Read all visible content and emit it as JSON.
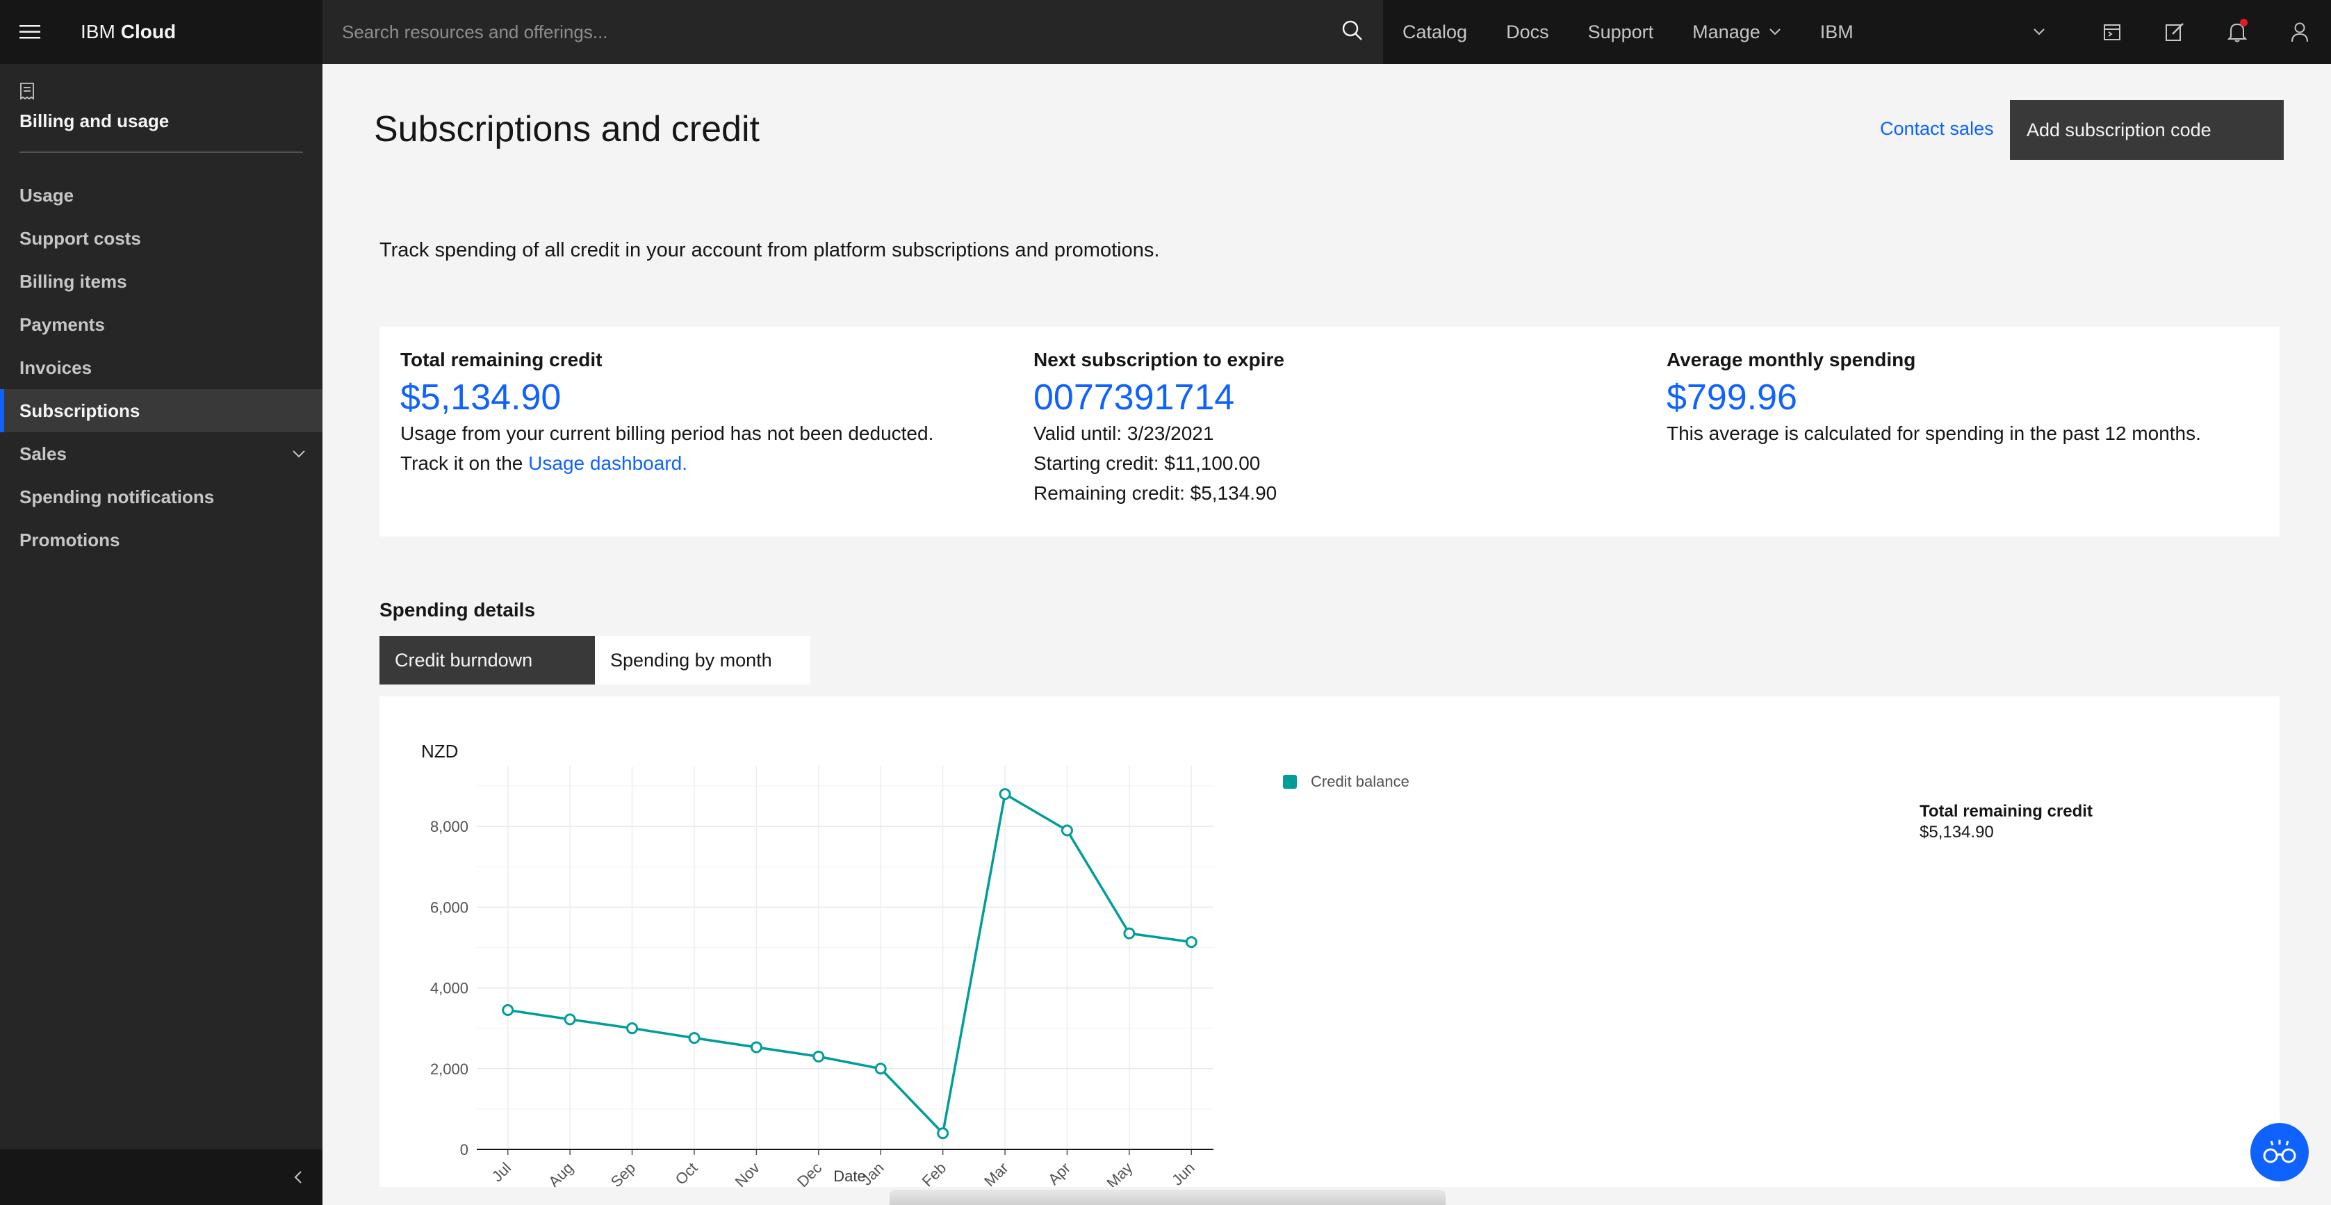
{
  "header": {
    "brand_prefix": "IBM",
    "brand_product": "Cloud",
    "search_placeholder": "Search resources and offerings...",
    "nav": [
      "Catalog",
      "Docs",
      "Support",
      "Manage"
    ],
    "account": "IBM"
  },
  "sidebar": {
    "title": "Billing and usage",
    "items": [
      {
        "label": "Usage"
      },
      {
        "label": "Support costs"
      },
      {
        "label": "Billing items"
      },
      {
        "label": "Payments"
      },
      {
        "label": "Invoices"
      },
      {
        "label": "Subscriptions",
        "active": true
      },
      {
        "label": "Sales",
        "expandable": true
      },
      {
        "label": "Spending notifications"
      },
      {
        "label": "Promotions"
      }
    ]
  },
  "page": {
    "title": "Subscriptions and credit",
    "contact_sales": "Contact sales",
    "add_subscription": "Add subscription code",
    "intro": "Track spending of all credit in your account from platform subscriptions and promotions."
  },
  "tiles": {
    "remaining": {
      "label": "Total remaining credit",
      "value": "$5,134.90",
      "line1": "Usage from your current billing period has not been deducted.",
      "line2_prefix": "Track it on the ",
      "line2_link": "Usage dashboard."
    },
    "next_expire": {
      "label": "Next subscription to expire",
      "value": "0077391714",
      "valid_until": "Valid until: 3/23/2021",
      "starting_credit": "Starting credit: $11,100.00",
      "remaining_credit": "Remaining credit: $5,134.90"
    },
    "average": {
      "label": "Average monthly spending",
      "value": "$799.96",
      "note": "This average is calculated for spending in the past 12 months."
    }
  },
  "spending": {
    "title": "Spending details",
    "tabs": [
      "Credit burndown",
      "Spending by month"
    ],
    "selected_tab": 0,
    "summary_label": "Total remaining credit",
    "summary_value": "$5,134.90"
  },
  "chart_data": {
    "type": "line",
    "title": "",
    "ylabel": "NZD",
    "xlabel": "Date",
    "categories": [
      "Jul",
      "Aug",
      "Sep",
      "Oct",
      "Nov",
      "Dec",
      "Jan",
      "Feb",
      "Mar",
      "Apr",
      "May",
      "Jun"
    ],
    "series": [
      {
        "name": "Credit balance",
        "color": "#009d9a",
        "values": [
          3450,
          3220,
          3000,
          2760,
          2530,
          2300,
          2000,
          400,
          8800,
          7900,
          5350,
          5135
        ]
      }
    ],
    "ylim": [
      0,
      9500
    ],
    "yticks": [
      0,
      2000,
      4000,
      6000,
      8000
    ],
    "ytick_labels": [
      "0",
      "2,000",
      "4,000",
      "6,000",
      "8,000"
    ],
    "grid": true,
    "legend_position": "right"
  },
  "colors": {
    "accent": "#0f62fe",
    "header_bg": "#161616",
    "sidebar_bg": "#262626",
    "series": "#009d9a"
  },
  "icons": [
    "menu-icon",
    "search-icon",
    "chevron-down-icon",
    "calendar-icon",
    "edit-icon",
    "notification-icon",
    "user-icon",
    "receipt-icon",
    "chevron-left-icon",
    "watson-help-icon"
  ]
}
